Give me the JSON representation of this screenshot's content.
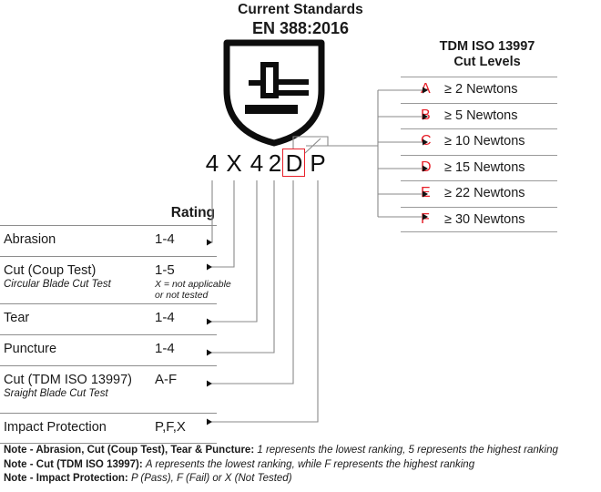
{
  "header": {
    "line1": "Current Standards",
    "line2": "EN 388:2016"
  },
  "pictogram": {
    "name": "mechanical-hazard-shield-glove-icon"
  },
  "code": {
    "characters": [
      "4",
      "X",
      "4",
      "2",
      "D",
      "P"
    ],
    "highlighted_index": 4,
    "highlight_color": "#e8202a"
  },
  "rating_table": {
    "title": "Rating",
    "rows": [
      {
        "label": "Abrasion",
        "sub": "",
        "value": "1-4",
        "note": ""
      },
      {
        "label": "Cut (Coup Test)",
        "sub": "Circular Blade Cut Test",
        "value": "1-5",
        "note": "X = not applicable\nor not tested"
      },
      {
        "label": "Tear",
        "sub": "",
        "value": "1-4",
        "note": ""
      },
      {
        "label": "Puncture",
        "sub": "",
        "value": "1-4",
        "note": ""
      },
      {
        "label": "Cut (TDM ISO 13997)",
        "sub": "Sraight Blade Cut Test",
        "value": "A-F",
        "note": ""
      },
      {
        "label": "Impact Protection",
        "sub": "",
        "value": "P,F,X",
        "note": ""
      }
    ]
  },
  "cut_levels": {
    "title_line1": "TDM ISO 13997",
    "title_line2": "Cut Levels",
    "letter_color": "#e8202a",
    "rows": [
      {
        "letter": "A",
        "value": "≥ 2 Newtons"
      },
      {
        "letter": "B",
        "value": "≥ 5 Newtons"
      },
      {
        "letter": "C",
        "value": "≥ 10 Newtons"
      },
      {
        "letter": "D",
        "value": "≥ 15 Newtons"
      },
      {
        "letter": "E",
        "value": "≥ 22 Newtons"
      },
      {
        "letter": "F",
        "value": "≥ 30 Newtons"
      }
    ]
  },
  "notes": [
    {
      "label": "Note - Abrasion, Cut (Coup Test), Tear & Puncture:",
      "text": "1 represents the lowest ranking, 5 represents the highest ranking"
    },
    {
      "label": "Note - Cut (TDM ISO 13997):",
      "text": "A represents the lowest ranking, while F represents the highest ranking"
    },
    {
      "label": "Note - Impact Protection:",
      "text": "P (Pass), F (Fail) or X (Not Tested)"
    }
  ]
}
